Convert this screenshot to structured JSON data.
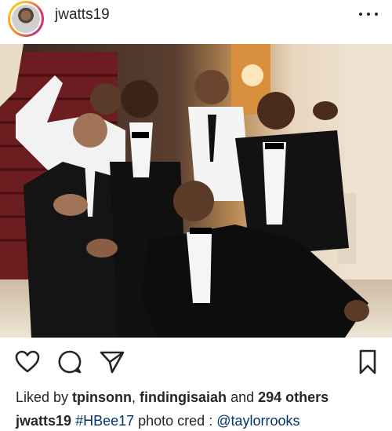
{
  "post": {
    "username": "jwatts19",
    "more_icon": "more-horizontal-icon",
    "photo_alt": "Group of men in black tuxedos posing together in an ornate hallway",
    "actions": {
      "like_icon": "heart-icon",
      "comment_icon": "comment-bubble-icon",
      "share_icon": "paper-plane-icon",
      "save_icon": "bookmark-icon"
    },
    "likes": {
      "prefix": "Liked by ",
      "user1": "tpinsonn",
      "separator": ", ",
      "user2": "findingisaiah",
      "and_text": " and ",
      "others": "294 others"
    },
    "caption": {
      "user": "jwatts19",
      "hashtag": "#HBee17",
      "text": " photo cred : ",
      "mention": "@taylorrooks"
    },
    "colors": {
      "text": "#262626",
      "link": "#003569",
      "story_ring": [
        "#f7b733",
        "#e1306c",
        "#c13584"
      ]
    }
  }
}
